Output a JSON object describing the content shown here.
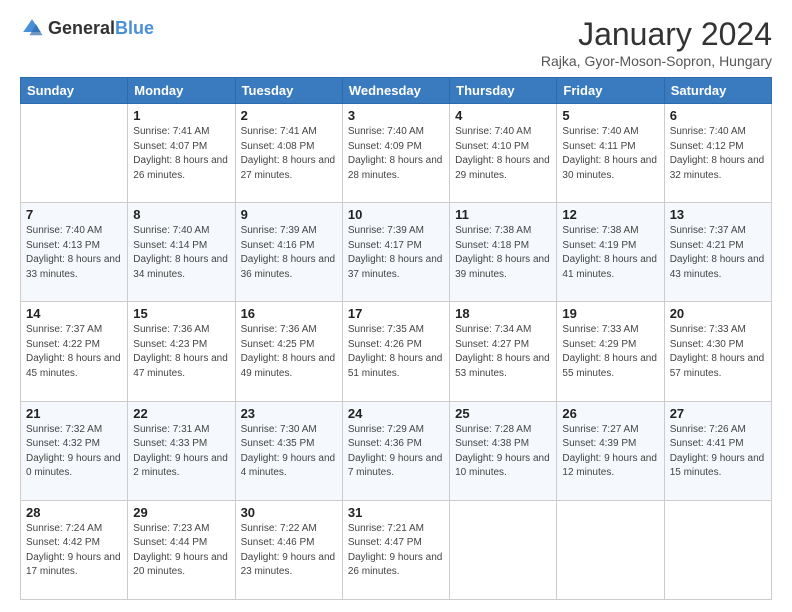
{
  "logo": {
    "general": "General",
    "blue": "Blue"
  },
  "title": "January 2024",
  "location": "Rajka, Gyor-Moson-Sopron, Hungary",
  "days_of_week": [
    "Sunday",
    "Monday",
    "Tuesday",
    "Wednesday",
    "Thursday",
    "Friday",
    "Saturday"
  ],
  "weeks": [
    [
      {
        "day": "",
        "sunrise": "",
        "sunset": "",
        "daylight": ""
      },
      {
        "day": "1",
        "sunrise": "Sunrise: 7:41 AM",
        "sunset": "Sunset: 4:07 PM",
        "daylight": "Daylight: 8 hours and 26 minutes."
      },
      {
        "day": "2",
        "sunrise": "Sunrise: 7:41 AM",
        "sunset": "Sunset: 4:08 PM",
        "daylight": "Daylight: 8 hours and 27 minutes."
      },
      {
        "day": "3",
        "sunrise": "Sunrise: 7:40 AM",
        "sunset": "Sunset: 4:09 PM",
        "daylight": "Daylight: 8 hours and 28 minutes."
      },
      {
        "day": "4",
        "sunrise": "Sunrise: 7:40 AM",
        "sunset": "Sunset: 4:10 PM",
        "daylight": "Daylight: 8 hours and 29 minutes."
      },
      {
        "day": "5",
        "sunrise": "Sunrise: 7:40 AM",
        "sunset": "Sunset: 4:11 PM",
        "daylight": "Daylight: 8 hours and 30 minutes."
      },
      {
        "day": "6",
        "sunrise": "Sunrise: 7:40 AM",
        "sunset": "Sunset: 4:12 PM",
        "daylight": "Daylight: 8 hours and 32 minutes."
      }
    ],
    [
      {
        "day": "7",
        "sunrise": "Sunrise: 7:40 AM",
        "sunset": "Sunset: 4:13 PM",
        "daylight": "Daylight: 8 hours and 33 minutes."
      },
      {
        "day": "8",
        "sunrise": "Sunrise: 7:40 AM",
        "sunset": "Sunset: 4:14 PM",
        "daylight": "Daylight: 8 hours and 34 minutes."
      },
      {
        "day": "9",
        "sunrise": "Sunrise: 7:39 AM",
        "sunset": "Sunset: 4:16 PM",
        "daylight": "Daylight: 8 hours and 36 minutes."
      },
      {
        "day": "10",
        "sunrise": "Sunrise: 7:39 AM",
        "sunset": "Sunset: 4:17 PM",
        "daylight": "Daylight: 8 hours and 37 minutes."
      },
      {
        "day": "11",
        "sunrise": "Sunrise: 7:38 AM",
        "sunset": "Sunset: 4:18 PM",
        "daylight": "Daylight: 8 hours and 39 minutes."
      },
      {
        "day": "12",
        "sunrise": "Sunrise: 7:38 AM",
        "sunset": "Sunset: 4:19 PM",
        "daylight": "Daylight: 8 hours and 41 minutes."
      },
      {
        "day": "13",
        "sunrise": "Sunrise: 7:37 AM",
        "sunset": "Sunset: 4:21 PM",
        "daylight": "Daylight: 8 hours and 43 minutes."
      }
    ],
    [
      {
        "day": "14",
        "sunrise": "Sunrise: 7:37 AM",
        "sunset": "Sunset: 4:22 PM",
        "daylight": "Daylight: 8 hours and 45 minutes."
      },
      {
        "day": "15",
        "sunrise": "Sunrise: 7:36 AM",
        "sunset": "Sunset: 4:23 PM",
        "daylight": "Daylight: 8 hours and 47 minutes."
      },
      {
        "day": "16",
        "sunrise": "Sunrise: 7:36 AM",
        "sunset": "Sunset: 4:25 PM",
        "daylight": "Daylight: 8 hours and 49 minutes."
      },
      {
        "day": "17",
        "sunrise": "Sunrise: 7:35 AM",
        "sunset": "Sunset: 4:26 PM",
        "daylight": "Daylight: 8 hours and 51 minutes."
      },
      {
        "day": "18",
        "sunrise": "Sunrise: 7:34 AM",
        "sunset": "Sunset: 4:27 PM",
        "daylight": "Daylight: 8 hours and 53 minutes."
      },
      {
        "day": "19",
        "sunrise": "Sunrise: 7:33 AM",
        "sunset": "Sunset: 4:29 PM",
        "daylight": "Daylight: 8 hours and 55 minutes."
      },
      {
        "day": "20",
        "sunrise": "Sunrise: 7:33 AM",
        "sunset": "Sunset: 4:30 PM",
        "daylight": "Daylight: 8 hours and 57 minutes."
      }
    ],
    [
      {
        "day": "21",
        "sunrise": "Sunrise: 7:32 AM",
        "sunset": "Sunset: 4:32 PM",
        "daylight": "Daylight: 9 hours and 0 minutes."
      },
      {
        "day": "22",
        "sunrise": "Sunrise: 7:31 AM",
        "sunset": "Sunset: 4:33 PM",
        "daylight": "Daylight: 9 hours and 2 minutes."
      },
      {
        "day": "23",
        "sunrise": "Sunrise: 7:30 AM",
        "sunset": "Sunset: 4:35 PM",
        "daylight": "Daylight: 9 hours and 4 minutes."
      },
      {
        "day": "24",
        "sunrise": "Sunrise: 7:29 AM",
        "sunset": "Sunset: 4:36 PM",
        "daylight": "Daylight: 9 hours and 7 minutes."
      },
      {
        "day": "25",
        "sunrise": "Sunrise: 7:28 AM",
        "sunset": "Sunset: 4:38 PM",
        "daylight": "Daylight: 9 hours and 10 minutes."
      },
      {
        "day": "26",
        "sunrise": "Sunrise: 7:27 AM",
        "sunset": "Sunset: 4:39 PM",
        "daylight": "Daylight: 9 hours and 12 minutes."
      },
      {
        "day": "27",
        "sunrise": "Sunrise: 7:26 AM",
        "sunset": "Sunset: 4:41 PM",
        "daylight": "Daylight: 9 hours and 15 minutes."
      }
    ],
    [
      {
        "day": "28",
        "sunrise": "Sunrise: 7:24 AM",
        "sunset": "Sunset: 4:42 PM",
        "daylight": "Daylight: 9 hours and 17 minutes."
      },
      {
        "day": "29",
        "sunrise": "Sunrise: 7:23 AM",
        "sunset": "Sunset: 4:44 PM",
        "daylight": "Daylight: 9 hours and 20 minutes."
      },
      {
        "day": "30",
        "sunrise": "Sunrise: 7:22 AM",
        "sunset": "Sunset: 4:46 PM",
        "daylight": "Daylight: 9 hours and 23 minutes."
      },
      {
        "day": "31",
        "sunrise": "Sunrise: 7:21 AM",
        "sunset": "Sunset: 4:47 PM",
        "daylight": "Daylight: 9 hours and 26 minutes."
      },
      {
        "day": "",
        "sunrise": "",
        "sunset": "",
        "daylight": ""
      },
      {
        "day": "",
        "sunrise": "",
        "sunset": "",
        "daylight": ""
      },
      {
        "day": "",
        "sunrise": "",
        "sunset": "",
        "daylight": ""
      }
    ]
  ]
}
